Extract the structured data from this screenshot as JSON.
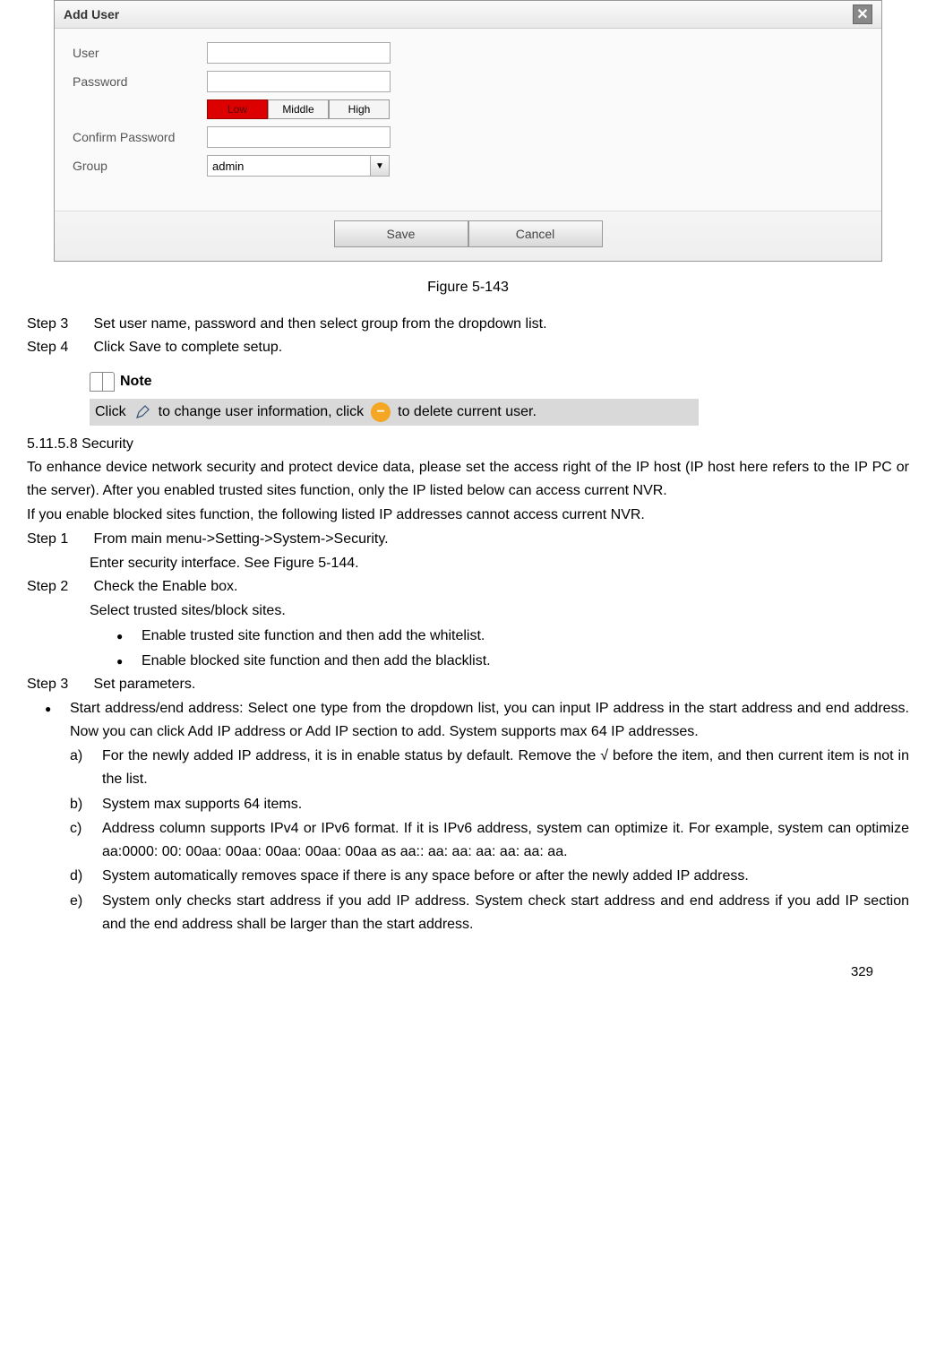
{
  "dialog": {
    "title": "Add User",
    "close": "✕",
    "userLabel": "User",
    "passwordLabel": "Password",
    "confirmLabel": "Confirm Password",
    "groupLabel": "Group",
    "groupValue": "admin",
    "strength": {
      "low": "Low",
      "middle": "Middle",
      "high": "High"
    },
    "save": "Save",
    "cancel": "Cancel"
  },
  "figureCaption": "Figure 5-143",
  "steps": {
    "s3label": "Step 3",
    "s3text": "Set user name, password and then select group from the dropdown list.",
    "s4label": "Step 4",
    "s4text": "Click Save to complete setup."
  },
  "note": {
    "title": "Note",
    "prefix": "Click",
    "mid": "to change user information, click",
    "suffix": "to delete current user."
  },
  "section": {
    "num": "5.11.5.8",
    "title": "Security"
  },
  "securityIntro1": "To enhance device network security and protect device data, please set the access right of the IP host (IP host here refers to the IP PC or the server). After you enabled trusted sites function, only the IP listed below can access current NVR.",
  "securityIntro2": "If you enable blocked sites function, the following listed IP addresses cannot access current NVR.",
  "secSteps": {
    "s1label": "Step 1",
    "s1text": "From main menu->Setting->System->Security.",
    "s1sub": "Enter security interface. See Figure 5-144.",
    "s2label": "Step 2",
    "s2text": "Check the Enable box.",
    "s2sub": "Select trusted sites/block sites.",
    "s3label": "Step 3",
    "s3text": "Set parameters."
  },
  "siteBullets": {
    "b1": "Enable trusted site function and then add the whitelist.",
    "b2": "Enable blocked site function and then add the blacklist."
  },
  "paramBullet": "Start address/end address: Select one type from the dropdown list, you can input IP address in the start address and end address. Now you can click Add IP address or Add IP section to add. System supports max 64 IP addresses.",
  "letters": {
    "a": "For the newly added IP address, it is in enable status by default. Remove the √ before the item, and then current item is not in the list.",
    "b": "System max supports 64 items.",
    "c": "Address column supports IPv4 or IPv6 format. If it is IPv6 address, system can optimize it. For example, system can optimize aa:0000: 00: 00aa: 00aa: 00aa: 00aa: 00aa as aa:: aa: aa: aa: aa: aa: aa.",
    "d": "System automatically removes space if there is any space before or after the newly added IP address.",
    "e": "System only checks start address if you add IP address. System check start address and end address if you add IP section and the end address shall be larger than the start address."
  },
  "pageNumber": "329"
}
